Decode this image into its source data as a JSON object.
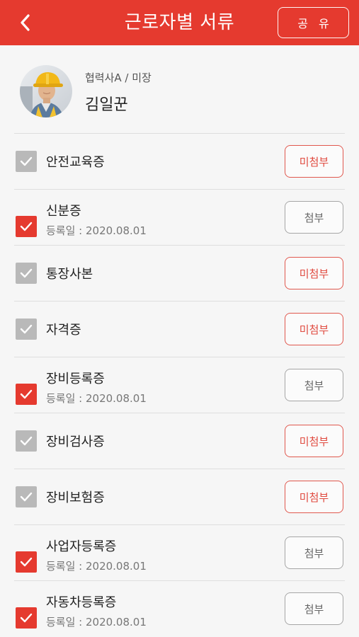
{
  "header": {
    "title": "근로자별 서류",
    "share_label": "공 유"
  },
  "profile": {
    "company_role": "협력사A / 미장",
    "name": "김일꾼"
  },
  "documents": [
    {
      "name": "안전교육증",
      "checked": false,
      "date": "",
      "status": "미첨부"
    },
    {
      "name": "신분증",
      "checked": true,
      "date": "등록일 : 2020.08.01",
      "status": "첨부"
    },
    {
      "name": "통장사본",
      "checked": false,
      "date": "",
      "status": "미첨부"
    },
    {
      "name": "자격증",
      "checked": false,
      "date": "",
      "status": "미첨부"
    },
    {
      "name": "장비등록증",
      "checked": true,
      "date": "등록일 : 2020.08.01",
      "status": "첨부"
    },
    {
      "name": "장비검사증",
      "checked": false,
      "date": "",
      "status": "미첨부"
    },
    {
      "name": "장비보험증",
      "checked": false,
      "date": "",
      "status": "미첨부"
    },
    {
      "name": "사업자등록증",
      "checked": true,
      "date": "등록일 : 2020.08.01",
      "status": "첨부"
    },
    {
      "name": "자동차등록증",
      "checked": true,
      "date": "등록일 : 2020.08.01",
      "status": "첨부"
    }
  ],
  "colors": {
    "accent": "#e53a2f",
    "unchecked": "#b9b9b9"
  },
  "icons": {
    "back": "chevron-left-icon",
    "check": "check-icon"
  }
}
